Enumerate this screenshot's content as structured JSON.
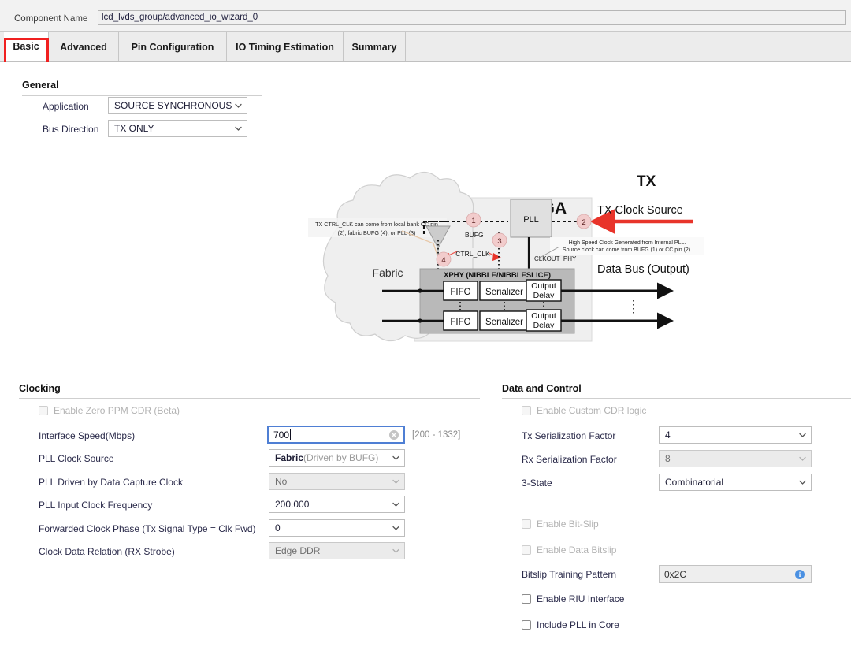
{
  "header": {
    "component_name_label": "Component Name",
    "component_name_value": "lcd_lvds_group/advanced_io_wizard_0"
  },
  "tabs": [
    {
      "label": "Basic",
      "selected": true
    },
    {
      "label": "Advanced",
      "selected": false
    },
    {
      "label": "Pin Configuration",
      "selected": false
    },
    {
      "label": "IO Timing Estimation",
      "selected": false
    },
    {
      "label": "Summary",
      "selected": false
    }
  ],
  "general": {
    "title": "General",
    "application_label": "Application",
    "application_value": "SOURCE SYNCHRONOUS",
    "bus_direction_label": "Bus Direction",
    "bus_direction_value": "TX ONLY"
  },
  "diagram": {
    "mode_title": "TX",
    "fpga_label": "FPGA",
    "fabric_label": "Fabric",
    "pll_label": "PLL",
    "bufg_label": "BUFG",
    "ctrl_clk_label": "CTRL_CLK",
    "clkout_phy_label": "CLKOUT_PHY",
    "xphy_label": "XPHY (NIBBLE/NIBBLESLICE)",
    "fifo_label": "FIFO",
    "serializer_label": "Serializer",
    "output_delay_label_1": "Output",
    "output_delay_label_2": "Delay",
    "tx_clock_source_label": "TX Clock Source",
    "data_bus_label": "Data Bus (Output)",
    "note_left_line1": "TX CTRL_CLK  can come from local bank CC pin",
    "note_left_line2": "(2), fabric BUFG (4), or PLL (3)",
    "note_right_line1": "High Speed Clock Generated from Internal PLL.",
    "note_right_line2": "Source clock can come from BUFG (1) or CC pin (2).",
    "markers": [
      "1",
      "2",
      "3",
      "4"
    ]
  },
  "clocking": {
    "title": "Clocking",
    "enable_zero_ppm_cdr": {
      "label": "Enable Zero PPM CDR (Beta)",
      "checked": false,
      "enabled": false
    },
    "rows": [
      {
        "label": "Interface Speed(Mbps)",
        "value": "700",
        "type": "text",
        "enabled": true,
        "focused": true,
        "hint": "[200 - 1332]"
      },
      {
        "label": "PLL Clock Source",
        "value": "Fabric",
        "value_suffix": "(Driven by BUFG)",
        "type": "combo",
        "enabled": true
      },
      {
        "label": "PLL Driven by Data Capture Clock",
        "value": "No",
        "type": "combo",
        "enabled": false
      },
      {
        "label": "PLL Input Clock Frequency",
        "value": "200.000",
        "type": "combo",
        "enabled": true
      },
      {
        "label": "Forwarded Clock Phase (Tx Signal Type = Clk Fwd)",
        "value": "0",
        "type": "combo",
        "enabled": true
      },
      {
        "label": "Clock Data Relation (RX Strobe)",
        "value": "Edge DDR",
        "type": "combo",
        "enabled": false
      }
    ]
  },
  "data_and_control": {
    "title": "Data and Control",
    "enable_custom_cdr": {
      "label": "Enable Custom CDR logic",
      "checked": false,
      "enabled": false
    },
    "rows": [
      {
        "label": "Tx Serialization Factor",
        "value": "4",
        "type": "combo",
        "enabled": true
      },
      {
        "label": "Rx Serialization Factor",
        "value": "8",
        "type": "combo",
        "enabled": false
      },
      {
        "label": "3-State",
        "value": "Combinatorial",
        "type": "combo",
        "enabled": true
      }
    ],
    "enable_bit_slip": {
      "label": "Enable Bit-Slip",
      "checked": false,
      "enabled": false
    },
    "enable_data_bitslip": {
      "label": "Enable Data Bitslip",
      "checked": false,
      "enabled": false
    },
    "bitslip_training_pattern": {
      "label": "Bitslip Training Pattern",
      "value": "0x2C",
      "enabled": false,
      "info": "i"
    },
    "enable_riu_interface": {
      "label": "Enable RIU Interface",
      "checked": false,
      "enabled": true
    },
    "include_pll_in_core": {
      "label": "Include PLL in Core",
      "checked": false,
      "enabled": true
    }
  },
  "colors": {
    "accent_red": "#f02020",
    "focus_blue": "#4f7fd4",
    "marker_pink": "#f0c8c8",
    "info_blue": "#4a90e2"
  }
}
